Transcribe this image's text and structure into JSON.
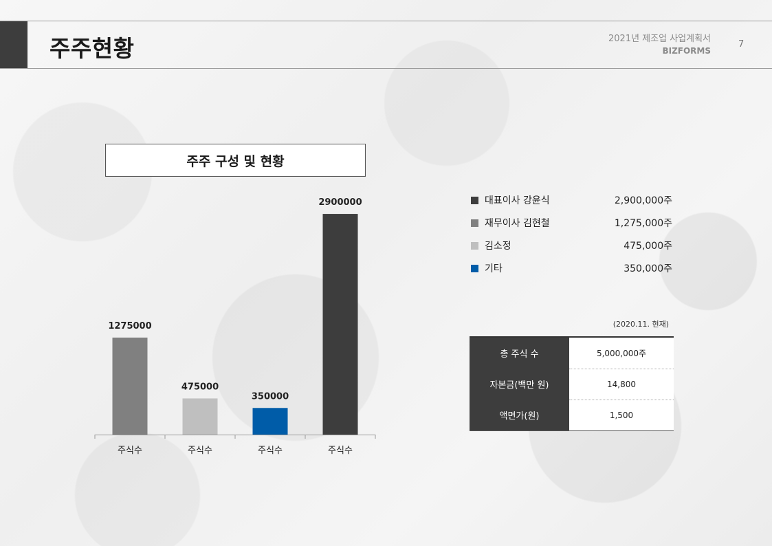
{
  "header": {
    "title": "주주현황",
    "doc_title": "2021년 제조업 사업계획서",
    "doc_sub": "BIZFORMS",
    "page_number": "7"
  },
  "chart_box_title": "주주 구성 및 현황",
  "chart_data": {
    "type": "bar",
    "categories": [
      "주식수",
      "주식수",
      "주식수",
      "주식수"
    ],
    "values": [
      1275000,
      475000,
      350000,
      2900000
    ],
    "value_labels": [
      "1275000",
      "475000",
      "350000",
      "2900000"
    ],
    "colors": [
      "#808080",
      "#bfbfbf",
      "#005ca8",
      "#3d3d3d"
    ],
    "ylim": [
      0,
      3000000
    ],
    "grid": false,
    "title": "",
    "xlabel": "",
    "ylabel": ""
  },
  "legend": [
    {
      "name": "대표이사 강윤식",
      "value": "2,900,000주",
      "color": "#3d3d3d"
    },
    {
      "name": "재무이사 김현철",
      "value": "1,275,000주",
      "color": "#808080"
    },
    {
      "name": "김소정",
      "value": "475,000주",
      "color": "#bfbfbf"
    },
    {
      "name": "기타",
      "value": "350,000주",
      "color": "#005ca8"
    }
  ],
  "as_of": "(2020.11. 현재)",
  "info_table": [
    {
      "label": "총 주식 수",
      "value": "5,000,000주"
    },
    {
      "label": "자본금(백만 원)",
      "value": "14,800"
    },
    {
      "label": "액면가(원)",
      "value": "1,500"
    }
  ]
}
